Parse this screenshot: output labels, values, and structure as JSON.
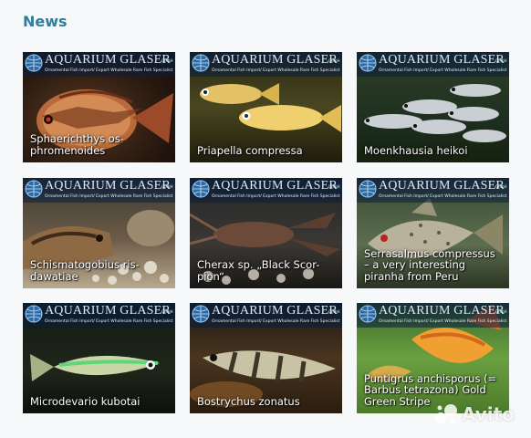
{
  "section": {
    "title": "News"
  },
  "brand": {
    "name": "AQUARIUM GLASER",
    "suffix": "GmbH",
    "tagline": "Ornamental Fish   Import/ Export Wholesale   Rare Fish Specialist"
  },
  "tiles": [
    {
      "caption": "Sphaerichthys os-phromenoides",
      "caption_lines": [
        "Sphaerichthys os-",
        "phromenoides"
      ],
      "scene": "gourami"
    },
    {
      "caption": "Priapella compressa",
      "caption_lines": [
        "Priapella compressa"
      ],
      "scene": "priapella"
    },
    {
      "caption": "Moenkhausia heikoi",
      "caption_lines": [
        "Moenkhausia heikoi"
      ],
      "scene": "tetra"
    },
    {
      "caption": "Schismatogobius ris-dawatiae",
      "caption_lines": [
        "Schismatogobius ris-",
        "dawatiae"
      ],
      "scene": "goby"
    },
    {
      "caption": "Cherax sp. „Black Scor-pion“",
      "caption_lines": [
        "Cherax sp. „Black Scor-",
        "pion“"
      ],
      "scene": "crayfish"
    },
    {
      "caption": "Serrasalmus compressus – a very interesting piranha from Peru",
      "caption_lines": [
        "Serrasalmus compressus",
        "– a very interesting",
        "piranha from Peru"
      ],
      "scene": "piranha"
    },
    {
      "caption": "Microdevario kubotai",
      "caption_lines": [
        "Microdevario kubotai"
      ],
      "scene": "microdevario"
    },
    {
      "caption": "Bostrychus zonatus",
      "caption_lines": [
        "Bostrychus zonatus"
      ],
      "scene": "bostrychus"
    },
    {
      "caption": "Puntigrus anchisporus (= Barbus tetrazona) Gold Green Stripe",
      "caption_lines": [
        "Puntigrus anchisporus (=",
        "Barbus tetrazona) Gold",
        "Green Stripe"
      ],
      "scene": "barb"
    }
  ],
  "watermark": {
    "text": "Avito"
  },
  "colors": {
    "heading": "#2e7d9a",
    "banner": "#0a1e3c",
    "caption": "#ffffff"
  }
}
